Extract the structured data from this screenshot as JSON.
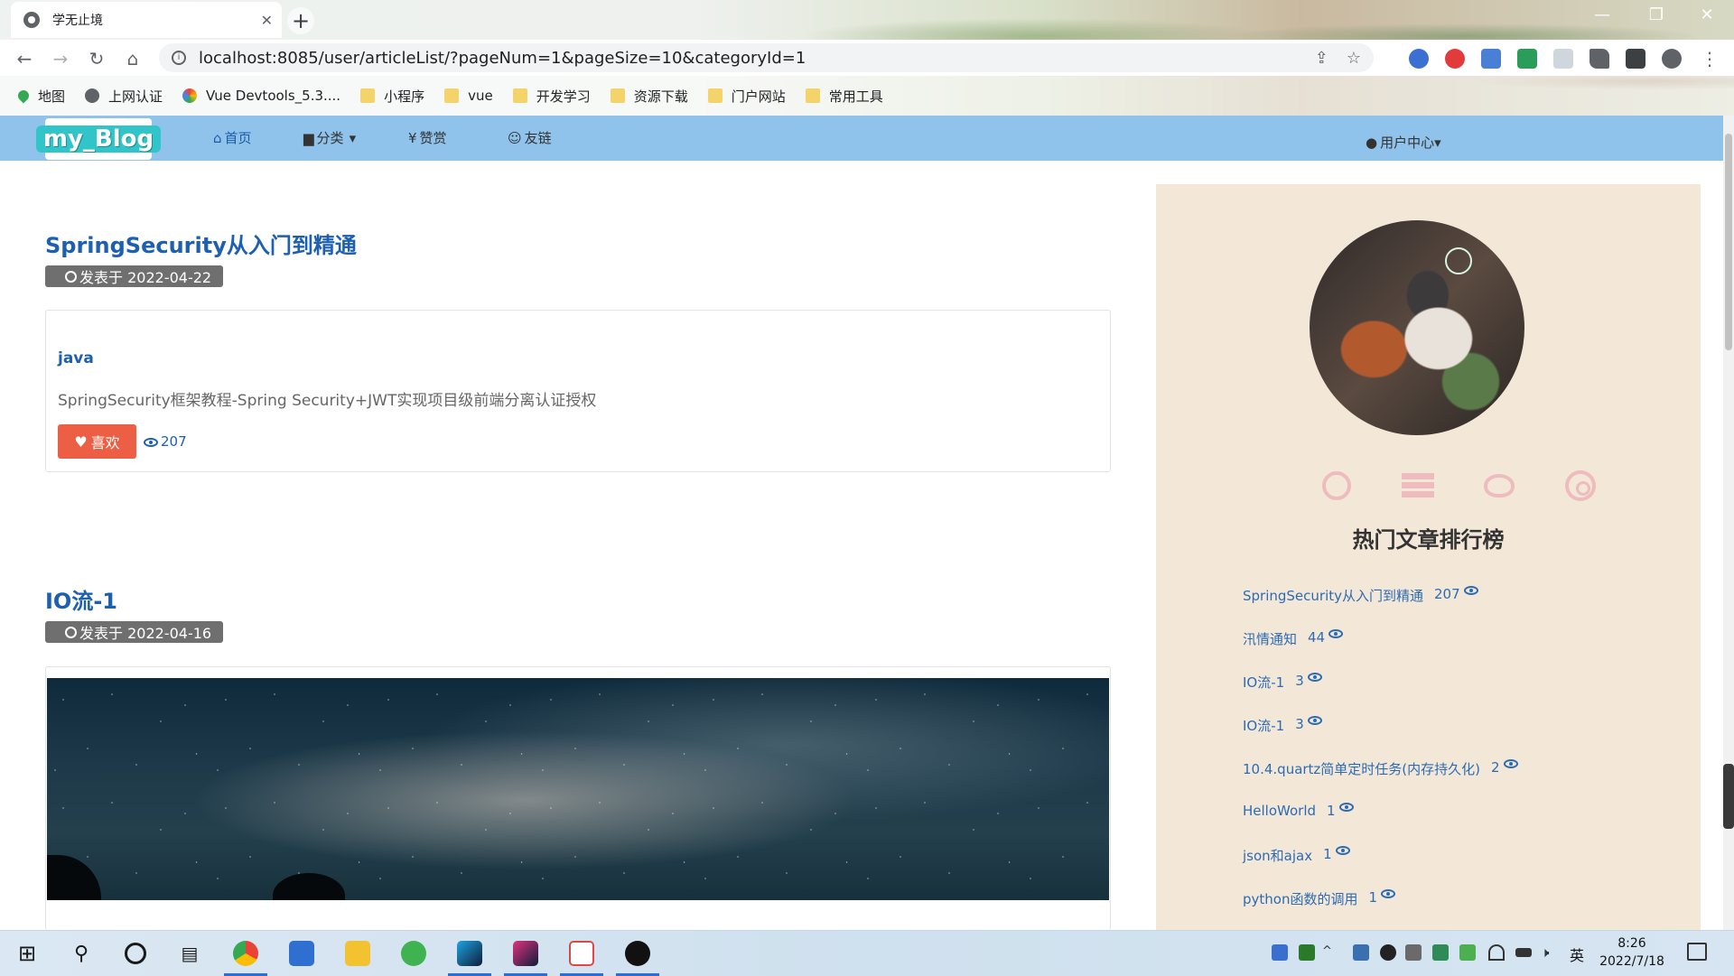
{
  "browser": {
    "tab_title": "学无止境",
    "tab_close": "✕",
    "new_tab": "+",
    "url": "localhost:8085/user/articleList/?pageNum=1&pageSize=10&categoryId=1",
    "bookmarks": [
      {
        "label": "地图",
        "icon": "map-pin-icon"
      },
      {
        "label": "上网认证",
        "icon": "globe-icon"
      },
      {
        "label": "Vue Devtools_5.3....",
        "icon": "rainbow-icon"
      },
      {
        "label": "小程序",
        "icon": "folder-icon"
      },
      {
        "label": "vue",
        "icon": "folder-icon"
      },
      {
        "label": "开发学习",
        "icon": "folder-icon"
      },
      {
        "label": "资源下载",
        "icon": "folder-icon"
      },
      {
        "label": "门户网站",
        "icon": "folder-icon"
      },
      {
        "label": "常用工具",
        "icon": "folder-icon"
      }
    ]
  },
  "navbar": {
    "logo": "my_Blog",
    "items": [
      {
        "label": "首页",
        "icon": "home-icon"
      },
      {
        "label": "分类",
        "icon": "archive-icon"
      },
      {
        "label": "赞赏",
        "icon": "yen-icon"
      },
      {
        "label": "友链",
        "icon": "smile-icon"
      }
    ],
    "user_center": "用户中心"
  },
  "posts": [
    {
      "title": "SpringSecurity从入门到精通",
      "date": "发表于 2022-04-22",
      "category": "java",
      "excerpt": "SpringSecurity框架教程-Spring Security+JWT实现项目级前端分离认证授权",
      "like_label": "喜欢",
      "views": "207"
    },
    {
      "title": "IO流-1",
      "date": "发表于 2022-04-16",
      "has_image": true
    }
  ],
  "sidebar": {
    "social_icons": [
      "github-icon",
      "server-icon",
      "weibo-icon",
      "chrome-icon"
    ],
    "rank_title": "热门文章排行榜",
    "rank": [
      {
        "title": "SpringSecurity从入门到精通",
        "count": "207"
      },
      {
        "title": "汛情通知",
        "count": "44"
      },
      {
        "title": "IO流-1",
        "count": "3"
      },
      {
        "title": "IO流-1",
        "count": "3"
      },
      {
        "title": "10.4.quartz简单定时任务(内存持久化)",
        "count": "2"
      },
      {
        "title": "HelloWorld",
        "count": "1"
      },
      {
        "title": "json和ajax",
        "count": "1"
      },
      {
        "title": "python函数的调用",
        "count": "1"
      }
    ]
  },
  "taskbar": {
    "ime": "英",
    "time": "8:26",
    "date": "2022/7/18"
  },
  "colors": {
    "navbar_bg": "#8fc3ec",
    "link": "#1d5fb0",
    "like_button": "#ec5f45",
    "sidebar_bg": "#f3e8d8"
  }
}
